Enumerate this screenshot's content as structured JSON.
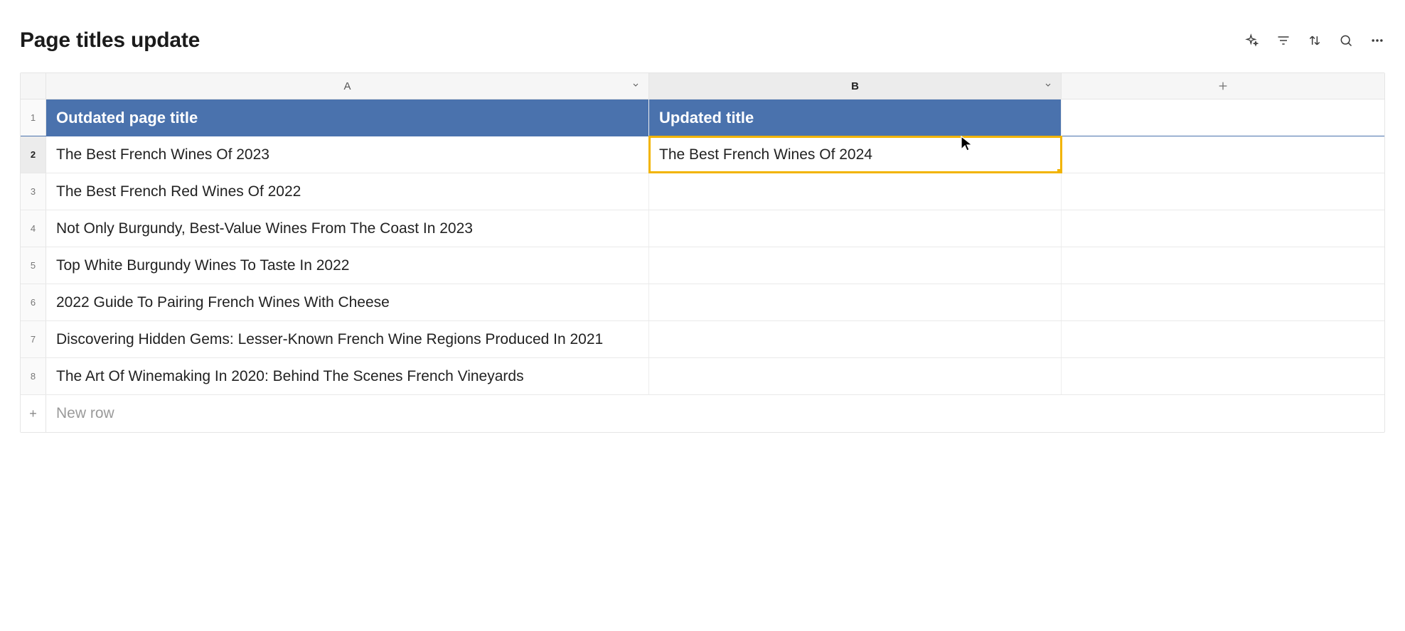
{
  "title": "Page titles update",
  "columns": {
    "a": "A",
    "b": "B"
  },
  "header_row": {
    "a": "Outdated page title",
    "b": "Updated title"
  },
  "rows": [
    {
      "n": "1"
    },
    {
      "n": "2",
      "a": "The Best French Wines Of 2023",
      "b": "The Best French Wines Of 2024"
    },
    {
      "n": "3",
      "a": "The Best French Red Wines Of 2022",
      "b": ""
    },
    {
      "n": "4",
      "a": "Not Only Burgundy, Best-Value Wines From The Coast In 2023",
      "b": ""
    },
    {
      "n": "5",
      "a": "Top White Burgundy Wines To Taste In 2022",
      "b": ""
    },
    {
      "n": "6",
      "a": "2022 Guide To Pairing French Wines With Cheese",
      "b": ""
    },
    {
      "n": "7",
      "a": "Discovering Hidden Gems: Lesser-Known French Wine Regions Produced In 2021",
      "b": ""
    },
    {
      "n": "8",
      "a": "The Art Of Winemaking In 2020: Behind The Scenes French Vineyards",
      "b": ""
    }
  ],
  "new_row_label": "New row",
  "selected_cell": "B2",
  "active_row": "2",
  "selected_column": "B"
}
